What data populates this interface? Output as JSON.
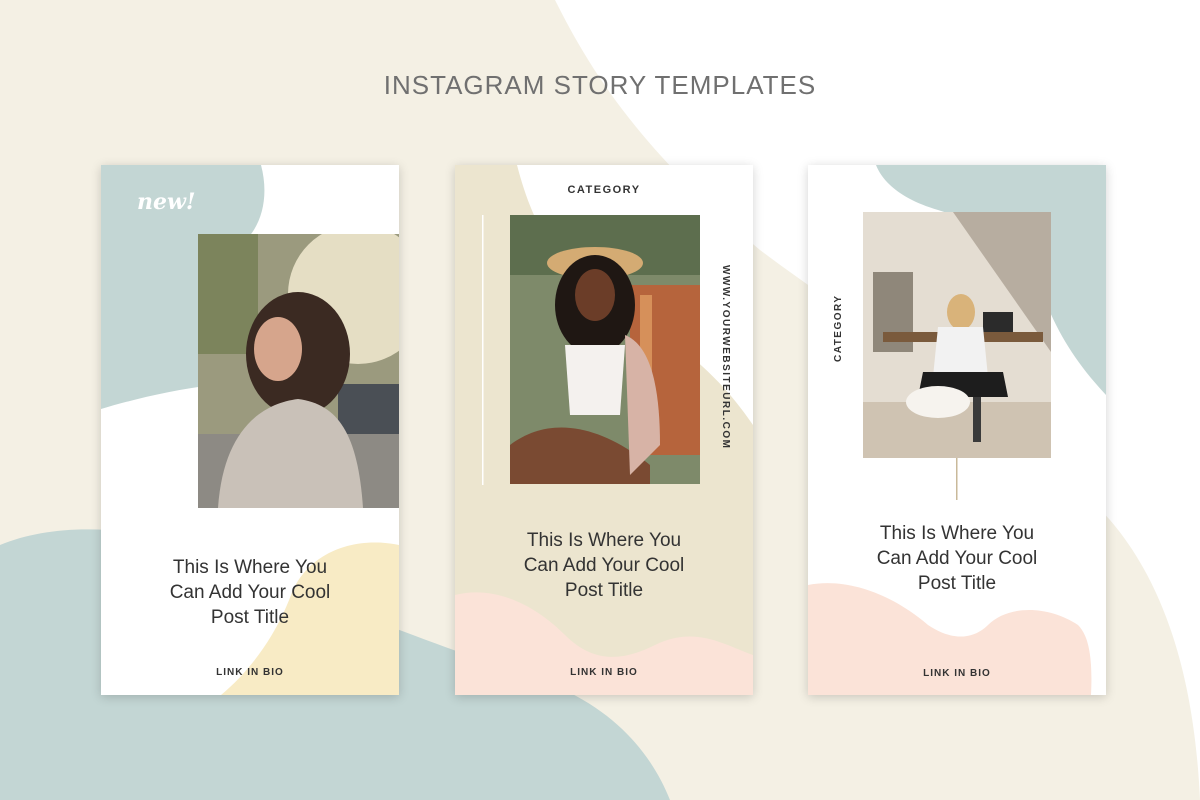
{
  "page": {
    "heading": "INSTAGRAM STORY TEMPLATES"
  },
  "colors": {
    "cream": "#f4f0e4",
    "sage": "#c3d6d4",
    "sand": "#ece5cf",
    "peach": "#fbe3d8",
    "butter": "#f8ebc5"
  },
  "cards": [
    {
      "badge": "new!",
      "title_lines": [
        "This Is Where You",
        "Can Add Your Cool",
        "Post Title"
      ],
      "link": "LINK IN BIO"
    },
    {
      "category": "CATEGORY",
      "website": "WWW.YOURWEBSITEURL.COM",
      "title_lines": [
        "This Is Where You",
        "Can Add Your Cool",
        "Post Title"
      ],
      "link": "LINK IN BIO"
    },
    {
      "category": "CATEGORY",
      "title_lines": [
        "This Is Where You",
        "Can Add Your Cool",
        "Post Title"
      ],
      "link": "LINK IN BIO"
    }
  ]
}
